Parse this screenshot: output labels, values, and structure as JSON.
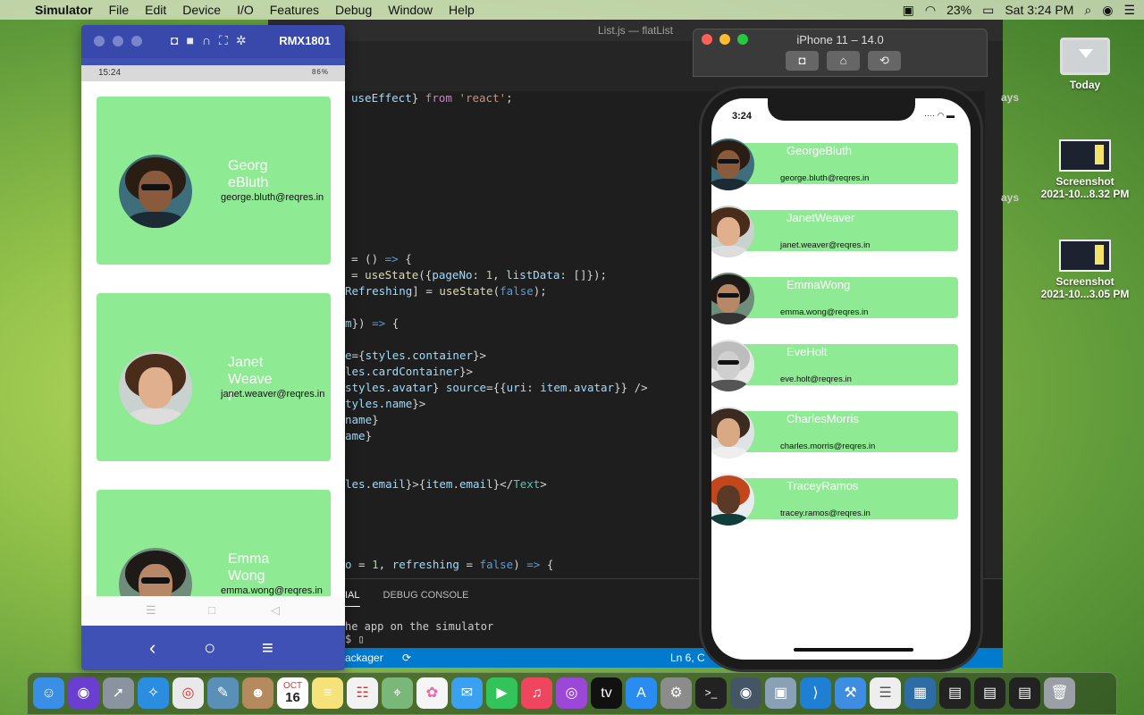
{
  "menubar": {
    "app": "Simulator",
    "items": [
      "File",
      "Edit",
      "Device",
      "I/O",
      "Features",
      "Debug",
      "Window",
      "Help"
    ],
    "battery": "23%",
    "clock": "Sat 3:24 PM"
  },
  "desktop": {
    "today": "Today",
    "shot1_l1": "Screenshot",
    "shot1_l2": "2021-10...8.32 PM",
    "shot2_l1": "Screenshot",
    "shot2_l2": "2021-10...3.05 PM"
  },
  "vscode": {
    "title": "List.js — flatList",
    "side_text_1": "ays",
    "side_text_2": "ays",
    "panel_tab_1": "IAL",
    "panel_tab_2": "DEBUG CONSOLE",
    "terminal_line_1": "he app on the simulator",
    "terminal_line_2": "$ ▯",
    "status_left": "ackager",
    "status_right": "Ln 6, C"
  },
  "android": {
    "device": "RMX1801",
    "time": "15:24",
    "status_right": "86%",
    "users": [
      {
        "name": "GeorgeBluth",
        "email": "george.bluth@reqres.in"
      },
      {
        "name": "JanetWeaver",
        "email": "janet.weaver@reqres.in"
      },
      {
        "name": "Emma Wong",
        "email": "emma.wong@reqres.in"
      }
    ]
  },
  "ios": {
    "title": "iPhone 11 – 14.0",
    "time": "3:24",
    "users": [
      {
        "name": "GeorgeBluth",
        "email": "george.bluth@reqres.in"
      },
      {
        "name": "JanetWeaver",
        "email": "janet.weaver@reqres.in"
      },
      {
        "name": "EmmaWong",
        "email": "emma.wong@reqres.in"
      },
      {
        "name": "EveHolt",
        "email": "eve.holt@reqres.in"
      },
      {
        "name": "CharlesMorris",
        "email": "charles.morris@reqres.in"
      },
      {
        "name": "TraceyRamos",
        "email": "tracey.ramos@reqres.in"
      }
    ]
  },
  "dock": {
    "calendar_month": "OCT",
    "calendar_day": "16"
  },
  "colors": {
    "card": "#8fea94",
    "android_chrome": "#3f51b5",
    "vscode_status": "#007acc"
  }
}
